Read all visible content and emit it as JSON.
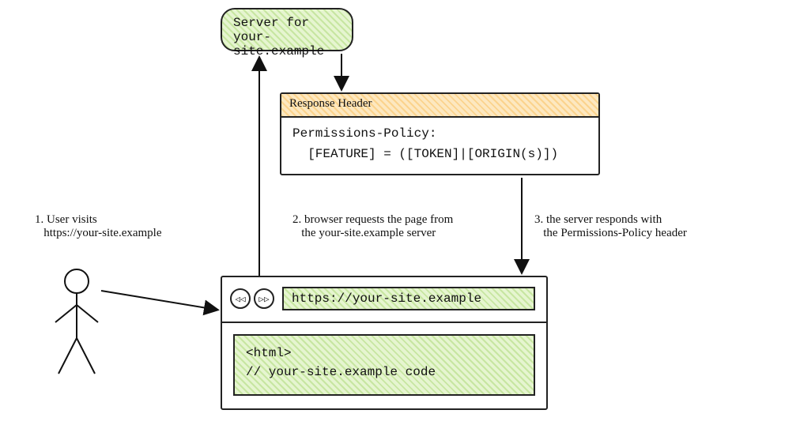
{
  "server": {
    "line1": "Server for",
    "line2": "your-site.example"
  },
  "response": {
    "header_title": "Response Header",
    "line1": "Permissions-Policy:",
    "line2": "  [FEATURE] = ([TOKEN]|[ORIGIN(s)])"
  },
  "browser": {
    "back_glyph": "◁◁",
    "fwd_glyph": "▷▷",
    "url": "https://your-site.example",
    "code_line1": "<html>",
    "code_line2": "// your-site.example code"
  },
  "steps": {
    "s1a": "1. User visits",
    "s1b": "   https://your-site.example",
    "s2a": "2. browser requests the page from",
    "s2b": "   the your-site.example server",
    "s3a": "3. the server responds with",
    "s3b": "   the Permissions-Policy header"
  }
}
